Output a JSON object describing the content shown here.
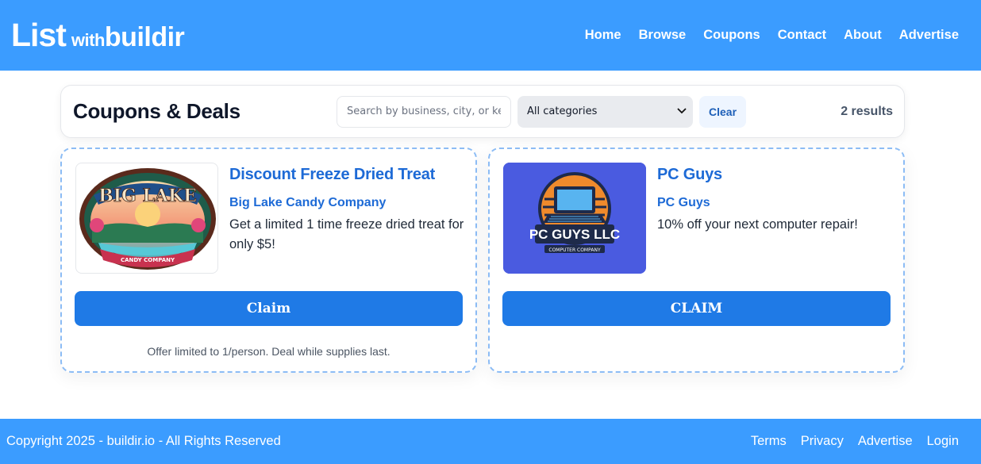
{
  "header": {
    "logo_main": "List",
    "logo_with": "with",
    "logo_brand": "buildir",
    "nav": [
      "Home",
      "Browse",
      "Coupons",
      "Contact",
      "About",
      "Advertise"
    ]
  },
  "toolbar": {
    "title": "Coupons & Deals",
    "search_placeholder": "Search by business, city, or keyword",
    "category_selected": "All categories",
    "clear_label": "Clear",
    "results": "2 results"
  },
  "coupons": [
    {
      "title": "Discount Freeze Dried Treat",
      "business": "Big Lake Candy Company",
      "description": "Get a limited 1 time freeze dried treat for only $5!",
      "claim_label": "Claim",
      "fine_print": "Offer limited to 1/person. Deal while supplies last.",
      "logo_text": "BIG LAKE",
      "logo_sub": "CANDY COMPANY"
    },
    {
      "title": "PC Guys",
      "business": "PC Guys",
      "description": "10% off your next computer repair!",
      "claim_label": "CLAIM",
      "logo_text": "PC GUYS LLC",
      "logo_sub": "COMPUTER COMPANY"
    }
  ],
  "footer": {
    "copyright": "Copyright 2025 - buildir.io - All Rights Reserved",
    "links": [
      "Terms",
      "Privacy",
      "Advertise",
      "Login"
    ]
  },
  "colors": {
    "brand_blue": "#3b9cff",
    "button_blue": "#1f7ae6",
    "link_blue": "#1d6ad6"
  }
}
